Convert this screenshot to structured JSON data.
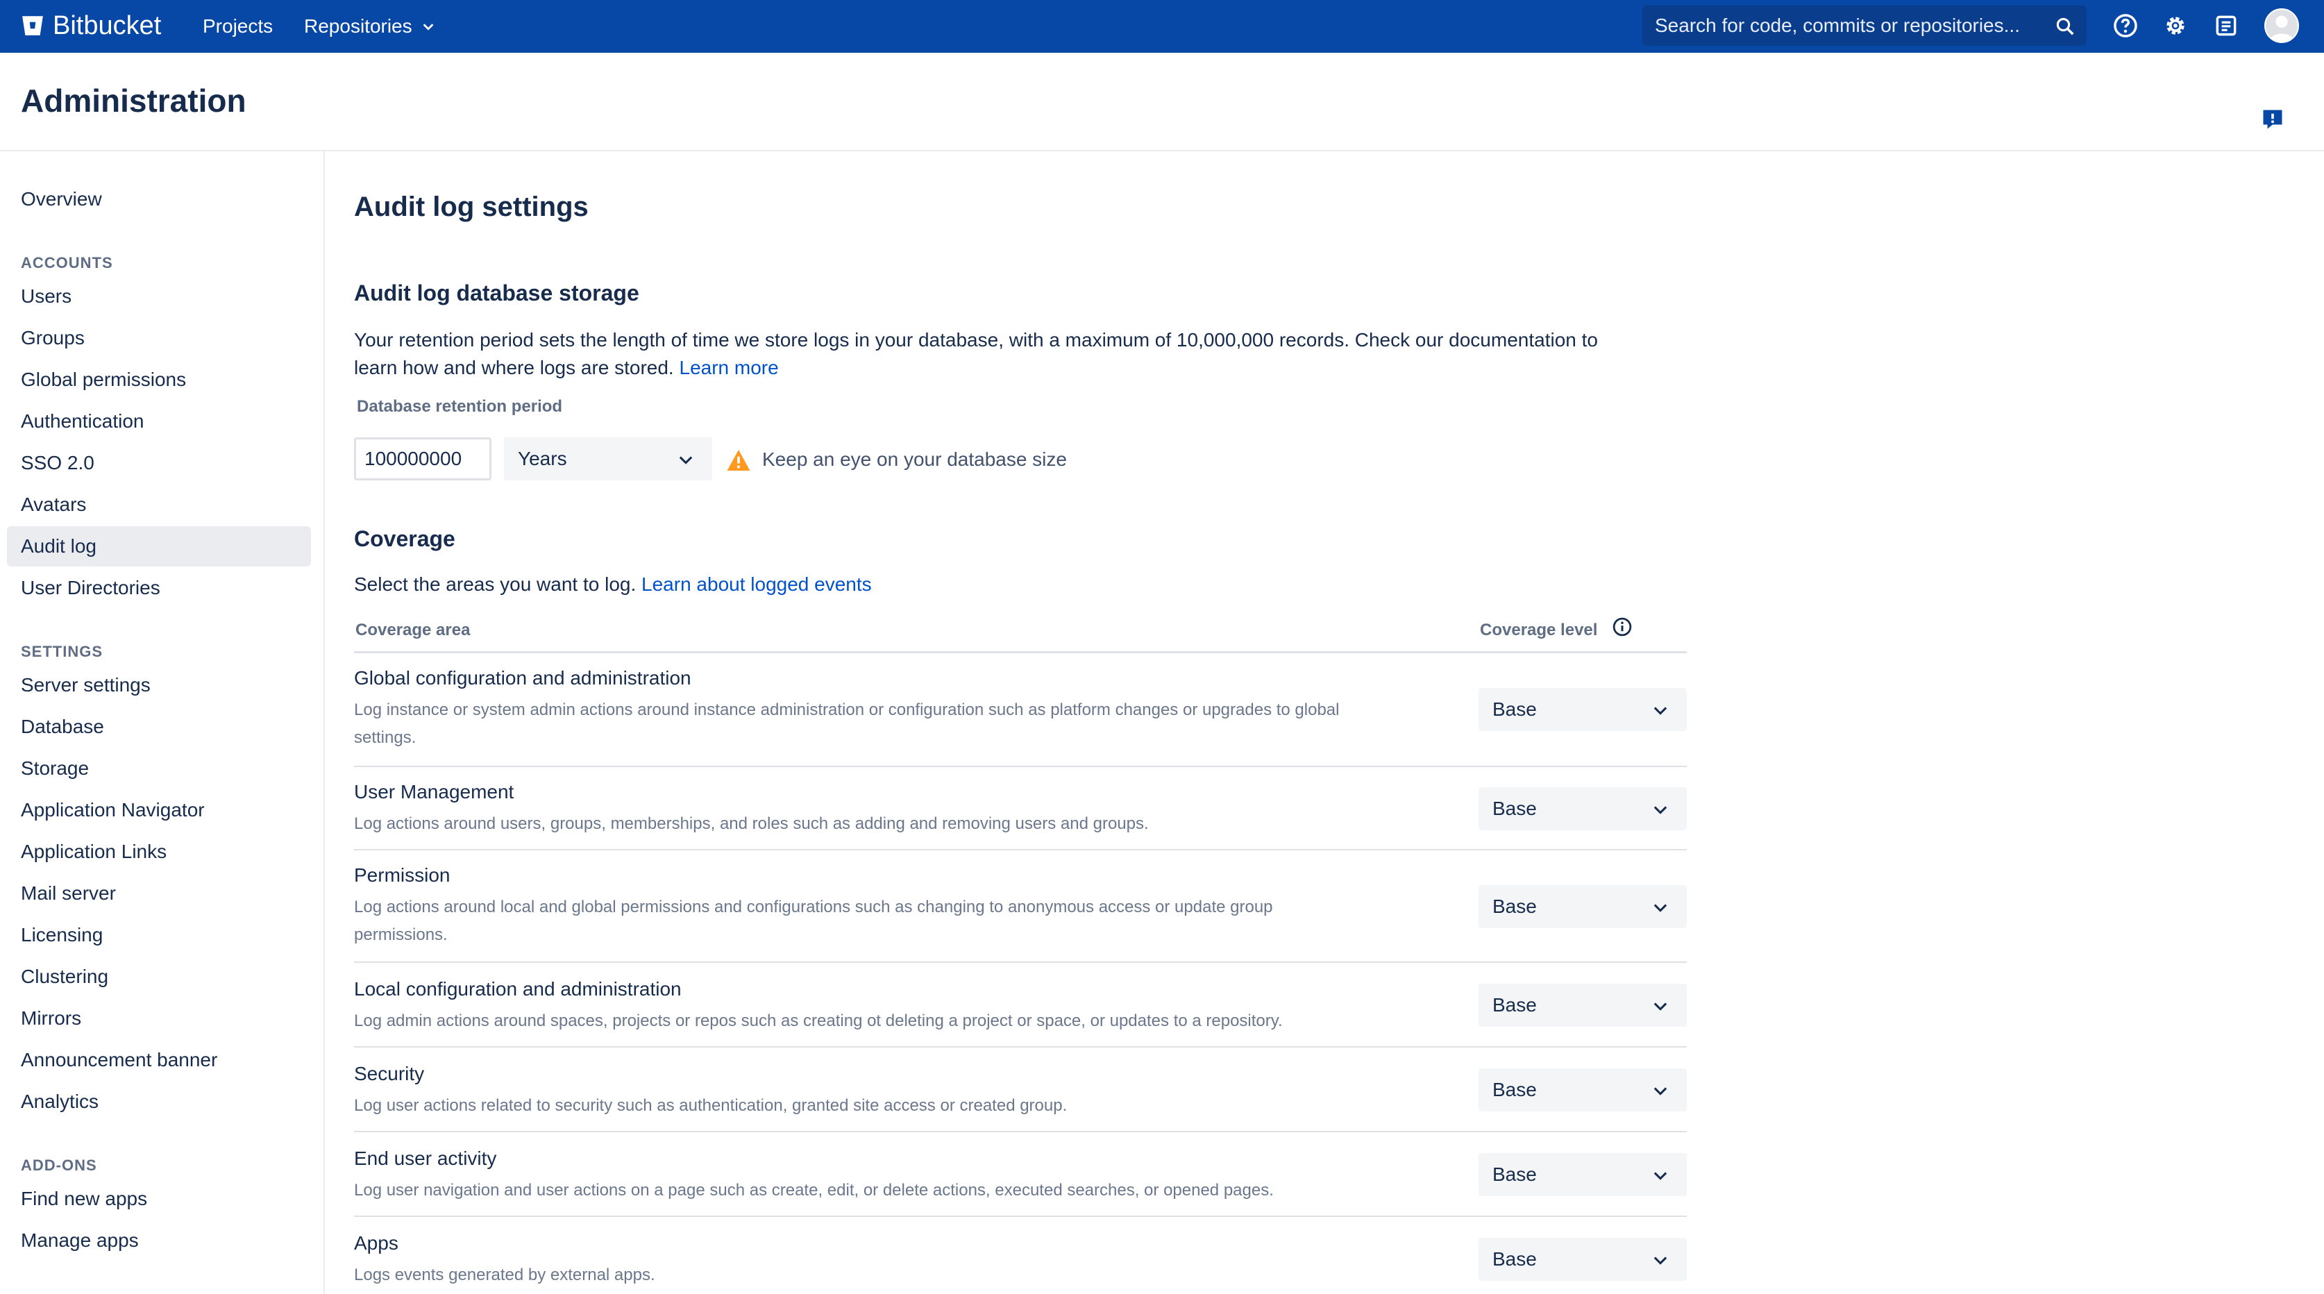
{
  "topnav": {
    "brand": "Bitbucket",
    "projects": "Projects",
    "repositories": "Repositories",
    "search_placeholder": "Search for code, commits or repositories...",
    "brand_color": "#0747a6"
  },
  "header": {
    "title": "Administration"
  },
  "sidebar": {
    "overview": "Overview",
    "accounts_heading": "ACCOUNTS",
    "accounts": [
      "Users",
      "Groups",
      "Global permissions",
      "Authentication",
      "SSO 2.0",
      "Avatars",
      "Audit log",
      "User Directories"
    ],
    "active_item": "Audit log",
    "settings_heading": "SETTINGS",
    "settings": [
      "Server settings",
      "Database",
      "Storage",
      "Application Navigator",
      "Application Links",
      "Mail server",
      "Licensing",
      "Clustering",
      "Mirrors",
      "Announcement banner",
      "Analytics"
    ],
    "addons_heading": "ADD-ONS",
    "addons": [
      "Find new apps",
      "Manage apps"
    ]
  },
  "main": {
    "title": "Audit log settings",
    "storage": {
      "heading": "Audit log database storage",
      "description_line1": "Your retention period sets the length of time we store logs in your database, with a maximum of 10,000,000 records. Check our documentation to",
      "description_line2": "learn how and where logs are stored.",
      "learn_more": "Learn more",
      "field_label": "Database retention period",
      "retention_value": "100000000",
      "unit": "Years",
      "warning": "Keep an eye on your database size"
    },
    "coverage": {
      "heading": "Coverage",
      "description": "Select the areas you want to log.",
      "learn_link": "Learn about logged events",
      "col_area": "Coverage area",
      "col_level": "Coverage level",
      "rows": [
        {
          "title": "Global configuration and administration",
          "desc1": "Log instance or system admin actions around instance administration or configuration such as platform changes or upgrades to global",
          "desc2": "settings.",
          "level": "Base"
        },
        {
          "title": "User Management",
          "desc1": "Log actions around users, groups, memberships, and roles such as adding and removing users and groups.",
          "desc2": "",
          "level": "Base"
        },
        {
          "title": "Permission",
          "desc1": "Log actions around local and global permissions and configurations such as changing to anonymous access or update group",
          "desc2": "permissions.",
          "level": "Base"
        },
        {
          "title": "Local configuration and administration",
          "desc1": "Log admin actions around spaces, projects or repos such as creating ot deleting a project or space, or updates to a repository.",
          "desc2": "",
          "level": "Base"
        },
        {
          "title": "Security",
          "desc1": "Log user actions related to security such as authentication, granted site access or created group.",
          "desc2": "",
          "level": "Base"
        },
        {
          "title": "End user activity",
          "desc1": "Log user navigation and user actions on a page such as create, edit, or delete actions, executed searches, or opened pages.",
          "desc2": "",
          "level": "Base"
        },
        {
          "title": "Apps",
          "desc1": "Logs events generated by external apps.",
          "desc2": "",
          "level": "Base"
        }
      ]
    }
  }
}
